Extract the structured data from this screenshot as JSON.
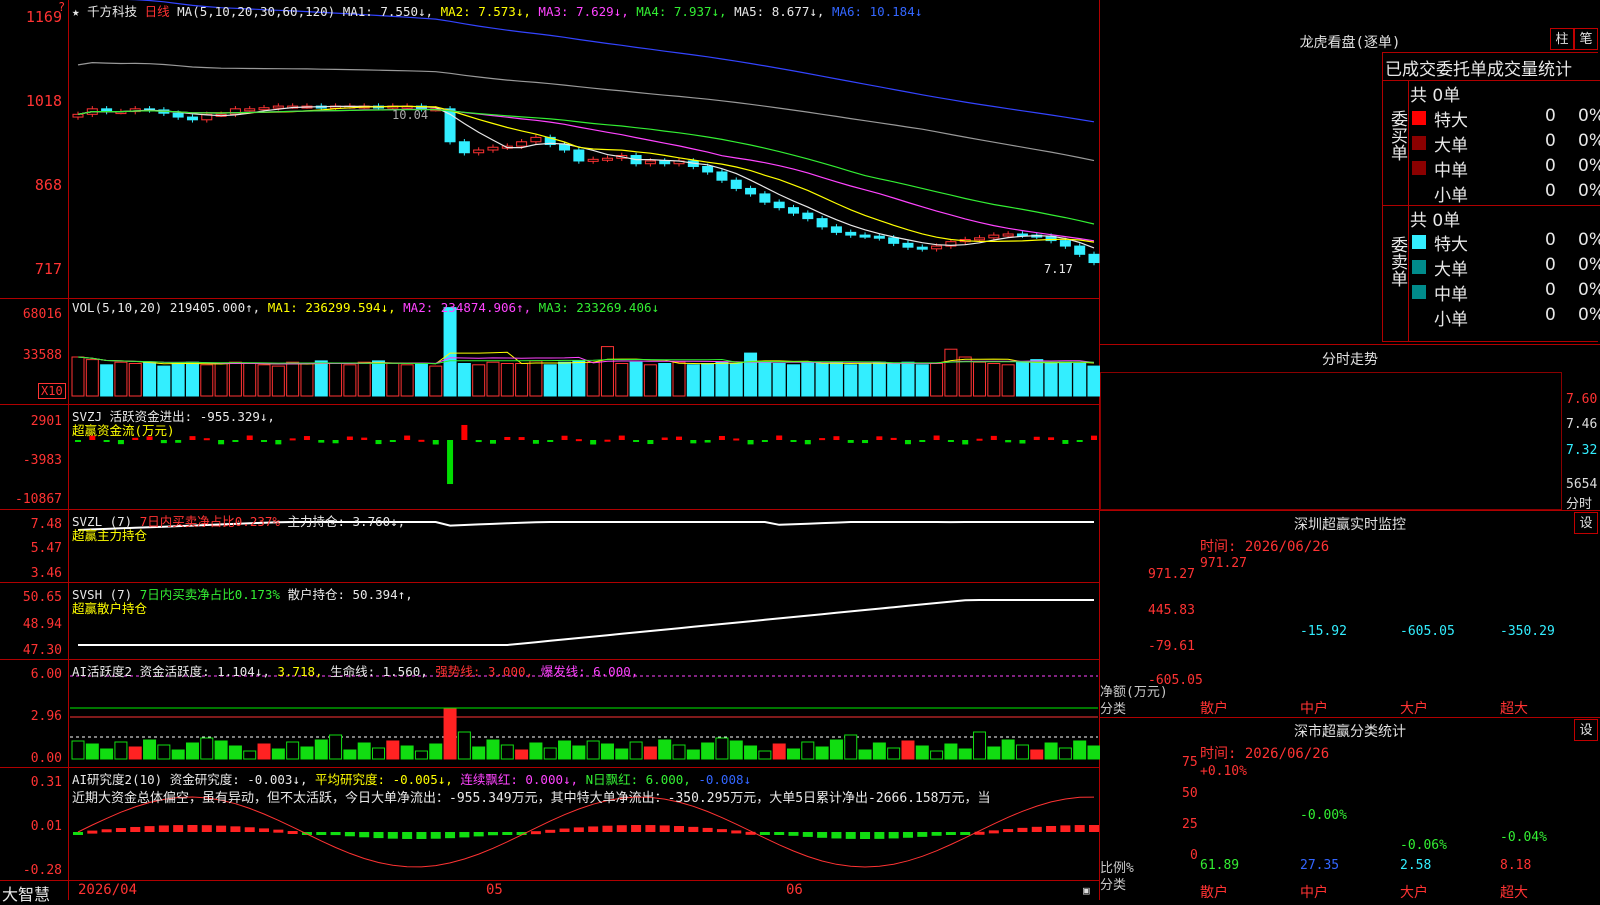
{
  "app": {
    "brand": "大智慧",
    "bottom_date": "2026/04",
    "month_labels": [
      "05",
      "06"
    ]
  },
  "main": {
    "header": {
      "star": "★",
      "stock_name": "千方科技",
      "period": "日线",
      "ma_params": "MA(5,10,20,30,60,120)",
      "ma1": "MA1: 7.550↓,",
      "ma2": "MA2: 7.573↓,",
      "ma3": "MA3: 7.629↓,",
      "ma4": "MA4: 7.937↓,",
      "ma5": "MA5: 8.677↓,",
      "ma6": "MA6: 10.184↓"
    },
    "y_labels": [
      "1169",
      "1018",
      "868",
      "717"
    ],
    "high_annot": "10.04",
    "low_annot": "7.17",
    "ylim": [
      6.7,
      11.8
    ],
    "closes": [
      9.9,
      10.0,
      9.95,
      9.95,
      10.0,
      9.98,
      9.92,
      9.85,
      9.8,
      9.9,
      9.9,
      10.0,
      10.0,
      10.02,
      10.05,
      10.05,
      10.05,
      10.02,
      10.05,
      10.05,
      10.05,
      10.03,
      10.05,
      10.05,
      10.0,
      10.0,
      9.4,
      9.2,
      9.25,
      9.3,
      9.32,
      9.4,
      9.48,
      9.35,
      9.25,
      9.05,
      9.08,
      9.1,
      9.15,
      9.0,
      9.05,
      9.0,
      9.05,
      8.95,
      8.85,
      8.7,
      8.55,
      8.45,
      8.3,
      8.2,
      8.1,
      8.0,
      7.85,
      7.75,
      7.7,
      7.68,
      7.65,
      7.55,
      7.48,
      7.45,
      7.5,
      7.58,
      7.62,
      7.65,
      7.7,
      7.72,
      7.7,
      7.68,
      7.6,
      7.5,
      7.35,
      7.2
    ],
    "ma_colors": [
      "#e8e8e8",
      "#ffff00",
      "#ff44ff",
      "#33ee33",
      "#999999",
      "#3344ff"
    ]
  },
  "vol": {
    "header": {
      "label": "VOL(5,10,20)",
      "value": "219405.000↑,",
      "ma1": "MA1: 236299.594↓,",
      "ma2": "MA2: 234874.906↑,",
      "ma3": "MA3: 233269.406↓"
    },
    "y_labels": [
      "68016",
      "33588"
    ],
    "unit": "X10",
    "values": [
      3,
      2.8,
      2.4,
      2.6,
      2.5,
      2.6,
      2.3,
      2.5,
      2.6,
      2.4,
      2.5,
      2.6,
      2.5,
      2.4,
      2.3,
      2.6,
      2.5,
      2.7,
      2.5,
      2.4,
      2.6,
      2.7,
      2.5,
      2.4,
      2.5,
      2.3,
      6.8,
      2.5,
      2.4,
      2.6,
      2.5,
      2.5,
      2.7,
      2.4,
      2.6,
      2.7,
      2.6,
      3.8,
      2.5,
      2.6,
      2.4,
      2.5,
      2.6,
      2.4,
      2.5,
      2.6,
      2.5,
      3.3,
      2.6,
      2.5,
      2.4,
      2.6,
      2.5,
      2.6,
      2.4,
      2.5,
      2.6,
      2.5,
      2.6,
      2.4,
      2.5,
      3.6,
      3.0,
      2.6,
      2.5,
      2.4,
      2.6,
      2.8,
      2.5,
      2.6,
      2.5,
      2.3
    ]
  },
  "svzj": {
    "header": {
      "label": "SVZJ",
      "title": "活跃资金进出: -955.329↓,",
      "sub": "超赢资金流(万元)"
    },
    "y_labels": [
      "2901",
      "-3983",
      "-10867"
    ]
  },
  "svzl": {
    "header": {
      "label": "SVZL (7)",
      "ratio": "7日内买卖净占比0.237%",
      "hold": "主力持仓: 3.760↓,",
      "sub": "超赢主力持仓"
    },
    "y_labels": [
      "7.48",
      "5.47",
      "3.46"
    ]
  },
  "svsh": {
    "header": {
      "label": "SVSH (7)",
      "ratio": "7日内买卖净占比0.173%",
      "hold": "散户持仓: 50.394↑,",
      "sub": "超赢散户持仓"
    },
    "y_labels": [
      "50.65",
      "48.94",
      "47.30"
    ]
  },
  "ai_active": {
    "header": {
      "label": "AI活跃度2",
      "a": "资金活跃度: 1.104↓,",
      "b": "3.718,",
      "c": "生命线: 1.560,",
      "d": "强势线: 3.000,",
      "e": "爆发线: 6.000,"
    },
    "y_labels": [
      "6.00",
      "2.96",
      "0.00"
    ]
  },
  "ai_research": {
    "header": {
      "label": "AI研究度2(10)",
      "a": "资金研究度: -0.003↓,",
      "b": "平均研究度: -0.005↓,",
      "c": "连续飘红: 0.000↓,",
      "d": "N日飘红: 6.000,",
      "e": "-0.008↓"
    },
    "text": "近期大资金总体偏空，虽有异动，但不太活跃，今日大单净流出：-955.349万元，其中特大单净流出：-350.295万元，大单5日累计净出-2666.158万元，当",
    "y_labels": [
      "0.31",
      "0.01",
      "-0.28"
    ]
  },
  "right": {
    "lhb_title": "龙虎看盘(逐单)",
    "btn_bar": "柱",
    "btn_stroke": "笔",
    "lhb_header": "已成交委托单成交量统计",
    "buy": {
      "side": "委买单",
      "total": "共 0单",
      "rows": [
        {
          "label": "特大",
          "v": "0",
          "p": "0%",
          "color": "#ff0000"
        },
        {
          "label": "大单",
          "v": "0",
          "p": "0%",
          "color": "#8b0000"
        },
        {
          "label": "中单",
          "v": "0",
          "p": "0%",
          "color": "#8b0000"
        },
        {
          "label": "小单",
          "v": "0",
          "p": "0%",
          "color": ""
        }
      ]
    },
    "sell": {
      "side": "委卖单",
      "total": "共 0单",
      "rows": [
        {
          "label": "特大",
          "v": "0",
          "p": "0%",
          "color": "#33eeff"
        },
        {
          "label": "大单",
          "v": "0",
          "p": "0%",
          "color": "#008b8b"
        },
        {
          "label": "中单",
          "v": "0",
          "p": "0%",
          "color": "#008b8b"
        },
        {
          "label": "小单",
          "v": "0",
          "p": "0%",
          "color": ""
        }
      ]
    },
    "fs_title": "分时走势",
    "fs_y": [
      "7.60",
      "7.46",
      "7.32"
    ],
    "fs_vol": "5654",
    "fs_unit": "分时",
    "mon_title": "深圳超赢实时监控",
    "mon_btn": "设",
    "mon_time": "时间: 2026/06/26",
    "mon_y": [
      "971.27",
      "445.83",
      "-79.61",
      "-605.05"
    ],
    "mon_bar_labels": [
      "971.27",
      "-15.92",
      "-605.05",
      "-350.29"
    ],
    "mon_net": "净额(万元)",
    "mon_cls": "分类",
    "mon_cats": [
      "散户",
      "中户",
      "大户",
      "超大"
    ],
    "cls_title": "深市超赢分类统计",
    "cls_btn": "设",
    "cls_time": "时间: 2026/06/26",
    "cls_y": [
      "75",
      "50",
      "25",
      "0"
    ],
    "cls_top": [
      "+0.10%",
      "-0.00%",
      "-0.06%",
      "-0.04%"
    ],
    "cls_bottom": [
      "61.89",
      "27.35",
      "2.58",
      "8.18"
    ],
    "cls_ratio": "比例%",
    "cls_cls": "分类",
    "cls_cats": [
      "散户",
      "中户",
      "大户",
      "超大"
    ]
  }
}
